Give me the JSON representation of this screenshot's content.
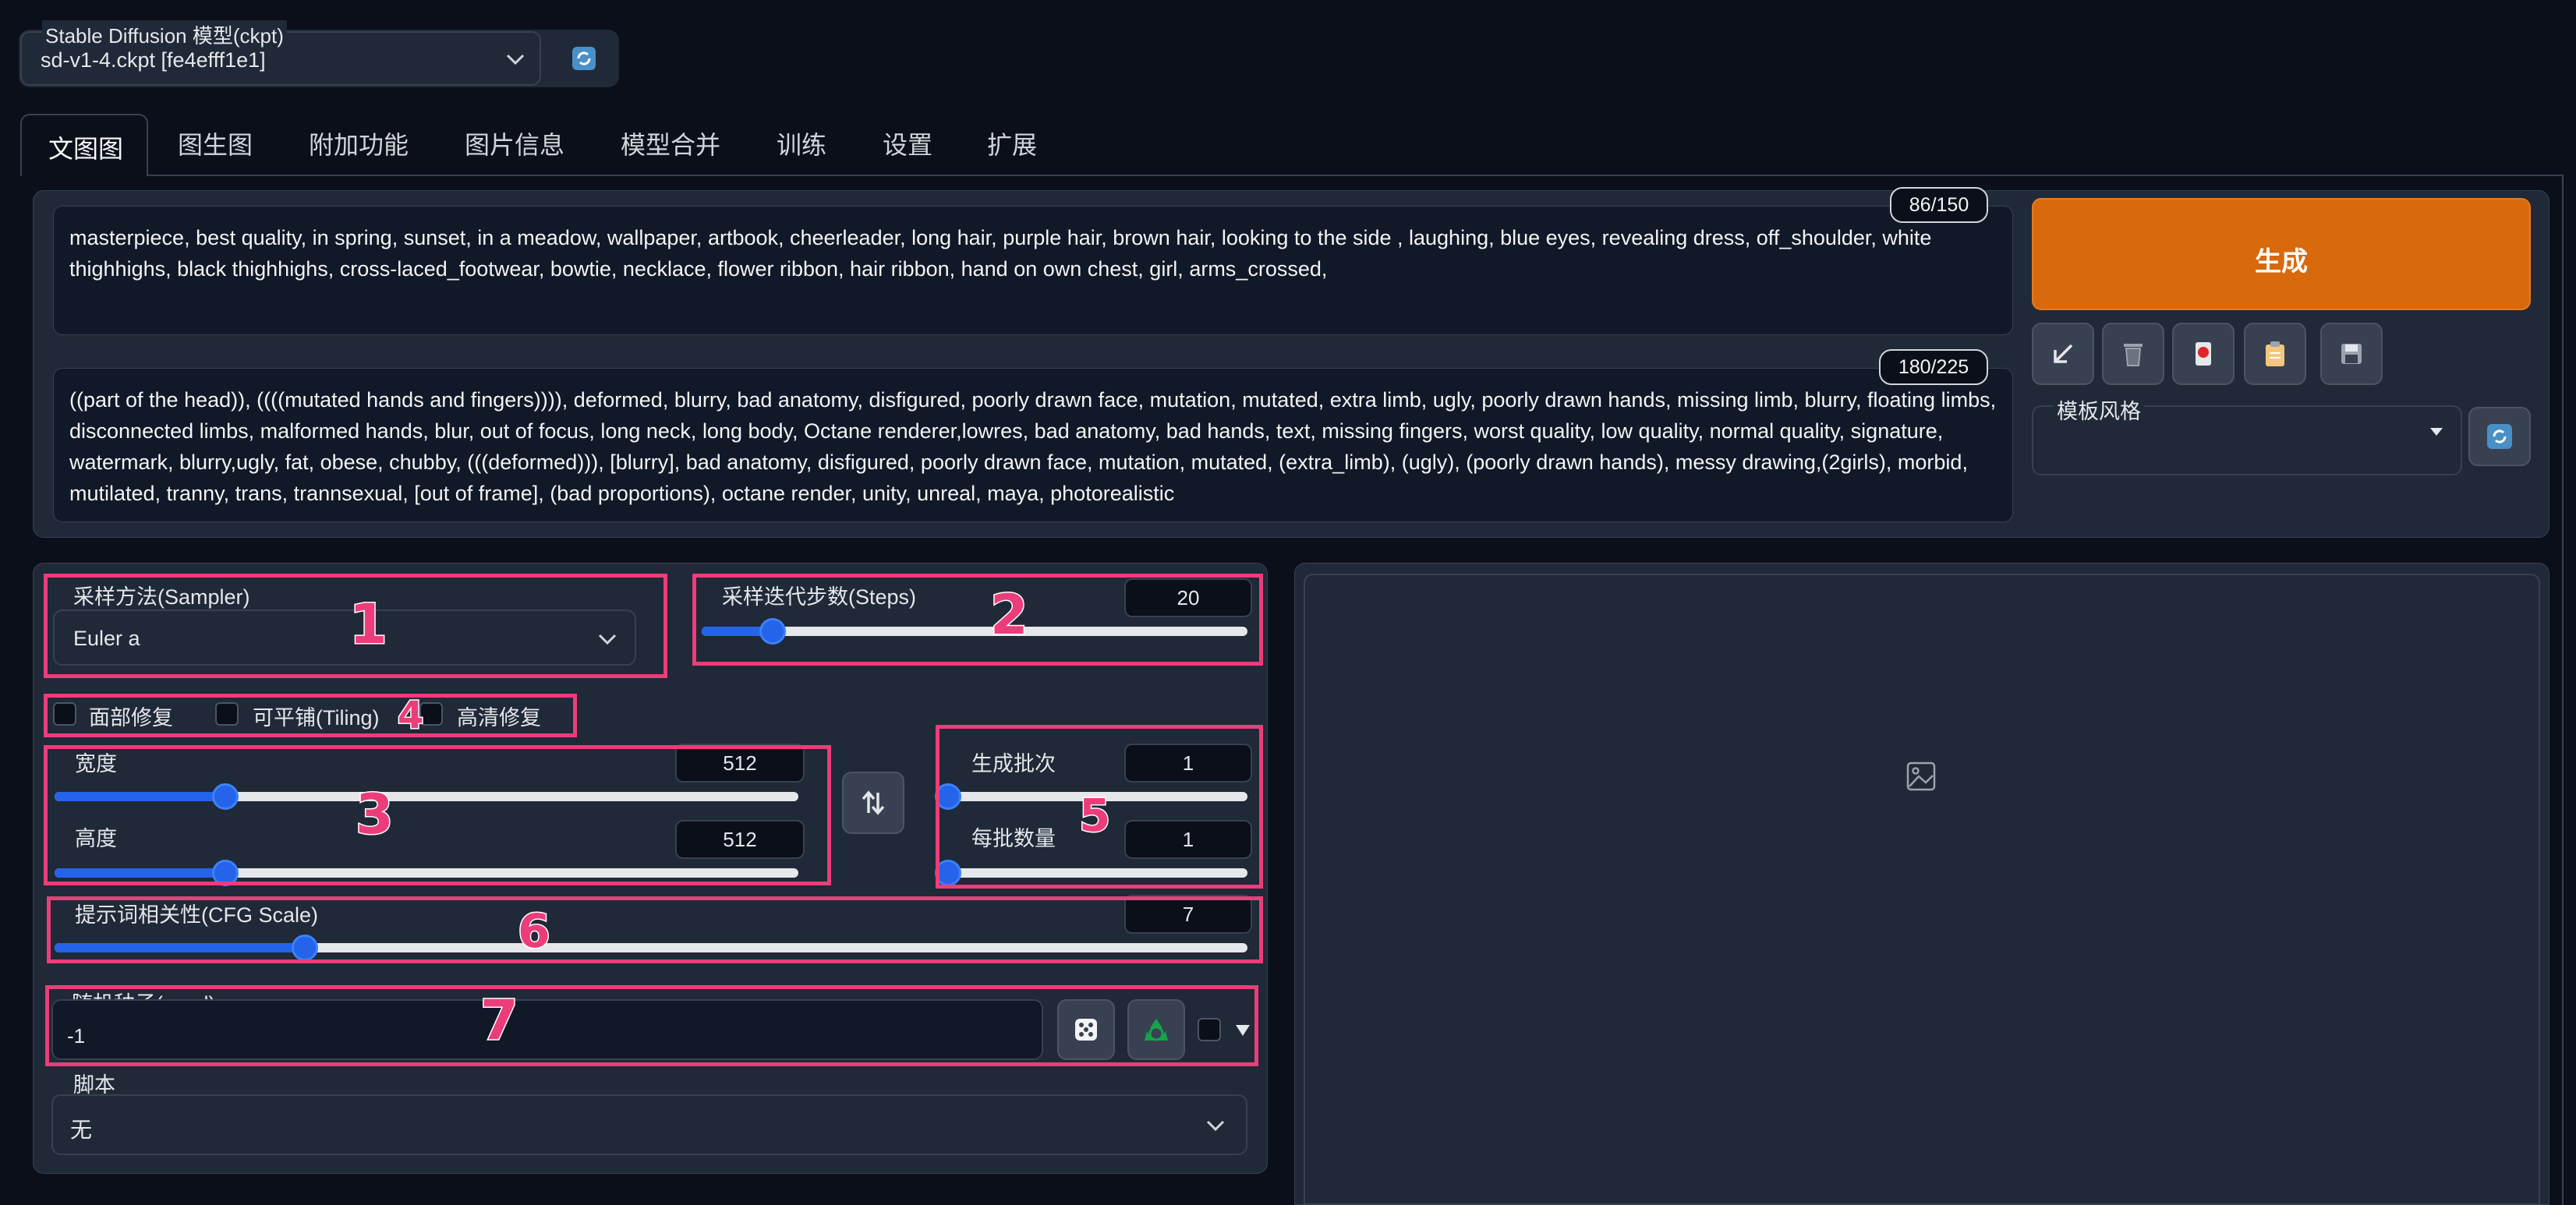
{
  "model": {
    "label": "Stable Diffusion 模型(ckpt)",
    "value": "sd-v1-4.ckpt [fe4efff1e1]"
  },
  "tabs": [
    "文图图",
    "图生图",
    "附加功能",
    "图片信息",
    "模型合并",
    "训练",
    "设置",
    "扩展"
  ],
  "prompt": {
    "counter": "86/150",
    "text": "masterpiece, best quality, in spring, sunset, in a meadow, wallpaper, artbook, cheerleader, long hair, purple hair, brown hair, looking to the side , laughing, blue eyes, revealing dress, off_shoulder, white thighhighs, black thighhighs, cross-laced_footwear, bowtie, necklace, flower ribbon, hair ribbon, hand on own chest, girl, arms_crossed,"
  },
  "negative_prompt": {
    "counter": "180/225",
    "text": "((part of the head)), ((((mutated hands and fingers)))), deformed, blurry, bad anatomy, disfigured, poorly drawn face, mutation, mutated, extra limb, ugly, poorly drawn hands, missing limb, blurry, floating limbs, disconnected limbs, malformed hands, blur, out of focus, long neck, long body, Octane renderer,lowres, bad anatomy, bad hands, text, missing fingers, worst quality, low quality, normal quality, signature, watermark, blurry,ugly, fat, obese, chubby, (((deformed))), [blurry], bad anatomy, disfigured, poorly drawn face, mutation, mutated, (extra_limb), (ugly), (poorly drawn hands), messy drawing,(2girls), morbid, mutilated, tranny, trans, trannsexual, [out of frame], (bad proportions), octane render, unity, unreal, maya, photorealistic"
  },
  "generate_label": "生成",
  "style": {
    "label": "模板风格",
    "value": ""
  },
  "sampler": {
    "label": "采样方法(Sampler)",
    "value": "Euler a"
  },
  "steps": {
    "label": "采样迭代步数(Steps)",
    "value": "20",
    "fraction": 0.13
  },
  "checkboxes": [
    "面部修复",
    "可平铺(Tiling)",
    "高清修复"
  ],
  "width": {
    "label": "宽度",
    "value": "512",
    "fraction": 0.23
  },
  "height": {
    "label": "高度",
    "value": "512",
    "fraction": 0.23
  },
  "batch_count": {
    "label": "生成批次",
    "value": "1",
    "fraction": 0.0
  },
  "batch_size": {
    "label": "每批数量",
    "value": "1",
    "fraction": 0.0
  },
  "cfg": {
    "label": "提示词相关性(CFG Scale)",
    "value": "7",
    "fraction": 0.21
  },
  "seed": {
    "label": "随机种子(seed)",
    "value": "-1"
  },
  "script": {
    "label": "脚本",
    "value": "无"
  },
  "annotations": [
    "1",
    "2",
    "3",
    "4",
    "5",
    "6",
    "7"
  ],
  "icons": [
    "refresh-icon",
    "arrow-down-left-icon",
    "trash-icon",
    "red-card-icon",
    "clipboard-icon",
    "save-icon",
    "swap-icon",
    "dice-icon",
    "recycle-icon",
    "image-placeholder-icon"
  ],
  "colors": {
    "generate": "#d8690d",
    "annotation": "#ec3d7a",
    "slider": "#2563eb",
    "background": "#0b0f19"
  }
}
